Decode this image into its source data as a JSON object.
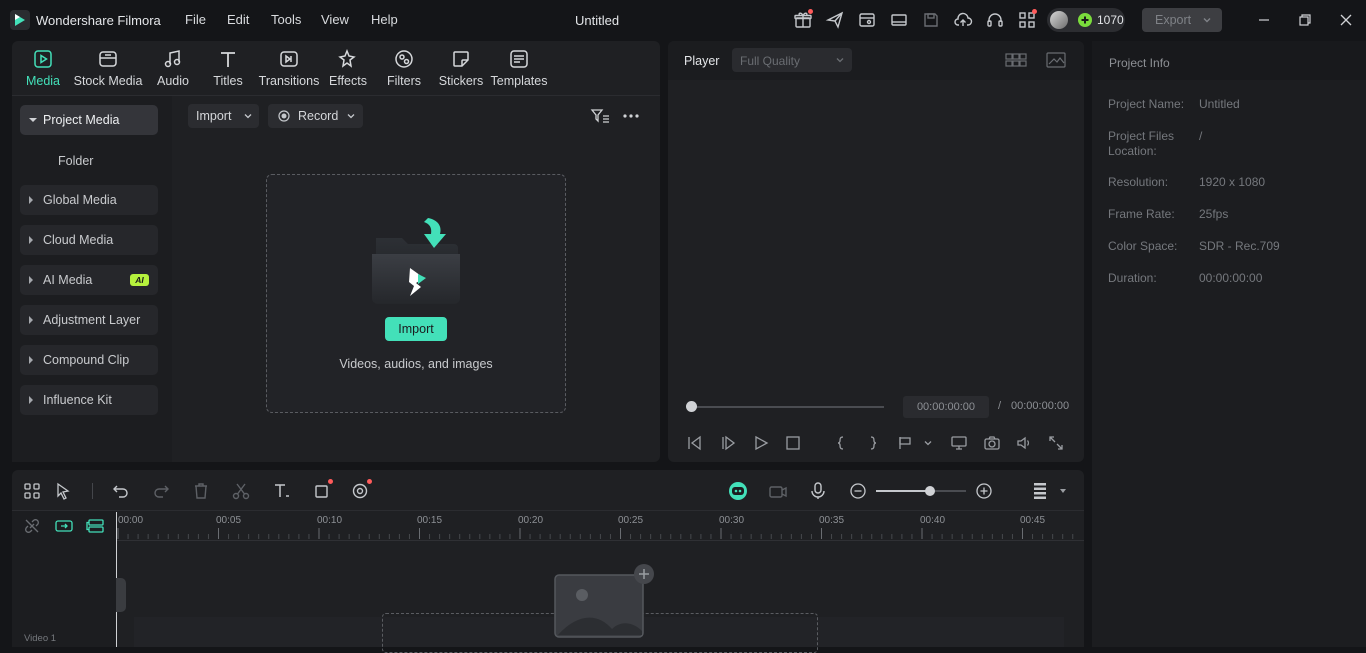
{
  "app": {
    "title": "Wondershare Filmora",
    "document_title": "Untitled"
  },
  "menu": [
    "File",
    "Edit",
    "Tools",
    "View",
    "Help"
  ],
  "credits": "1070",
  "export_label": "Export",
  "tabs": [
    {
      "label": "Media",
      "icon": "media-icon",
      "active": true
    },
    {
      "label": "Stock Media",
      "icon": "stock-media-icon"
    },
    {
      "label": "Audio",
      "icon": "audio-icon"
    },
    {
      "label": "Titles",
      "icon": "titles-icon"
    },
    {
      "label": "Transitions",
      "icon": "transitions-icon"
    },
    {
      "label": "Effects",
      "icon": "effects-icon"
    },
    {
      "label": "Filters",
      "icon": "filters-icon"
    },
    {
      "label": "Stickers",
      "icon": "stickers-icon"
    },
    {
      "label": "Templates",
      "icon": "templates-icon"
    }
  ],
  "sidebar": {
    "project_media": "Project Media",
    "folder": "Folder",
    "items": [
      "Global Media",
      "Cloud Media",
      "AI Media",
      "Adjustment Layer",
      "Compound Clip",
      "Influence Kit"
    ],
    "ai_badge": "AI"
  },
  "media": {
    "import_label": "Import",
    "record_label": "Record",
    "drop_button": "Import",
    "drop_hint": "Videos, audios, and images"
  },
  "player": {
    "label": "Player",
    "quality": "Full Quality",
    "current_time": "00:00:00:00",
    "separator": "/",
    "total_time": "00:00:00:00"
  },
  "project_info": {
    "header": "Project Info",
    "fields": [
      {
        "label": "Project Name:",
        "value": "Untitled"
      },
      {
        "label": "Project Files Location:",
        "value": "/"
      },
      {
        "label": "Resolution:",
        "value": "1920 x 1080"
      },
      {
        "label": "Frame Rate:",
        "value": "25fps"
      },
      {
        "label": "Color Space:",
        "value": "SDR - Rec.709"
      },
      {
        "label": "Duration:",
        "value": "00:00:00:00"
      }
    ]
  },
  "timeline": {
    "ruler": [
      "00:00",
      "00:05",
      "00:10",
      "00:15",
      "00:20",
      "00:25",
      "00:30",
      "00:35",
      "00:40",
      "00:45"
    ],
    "track_label": "Video 1",
    "zoom_level": 0.6
  },
  "colors": {
    "accent": "#43e0b9",
    "background": "#141518",
    "panel": "#1f2023"
  }
}
